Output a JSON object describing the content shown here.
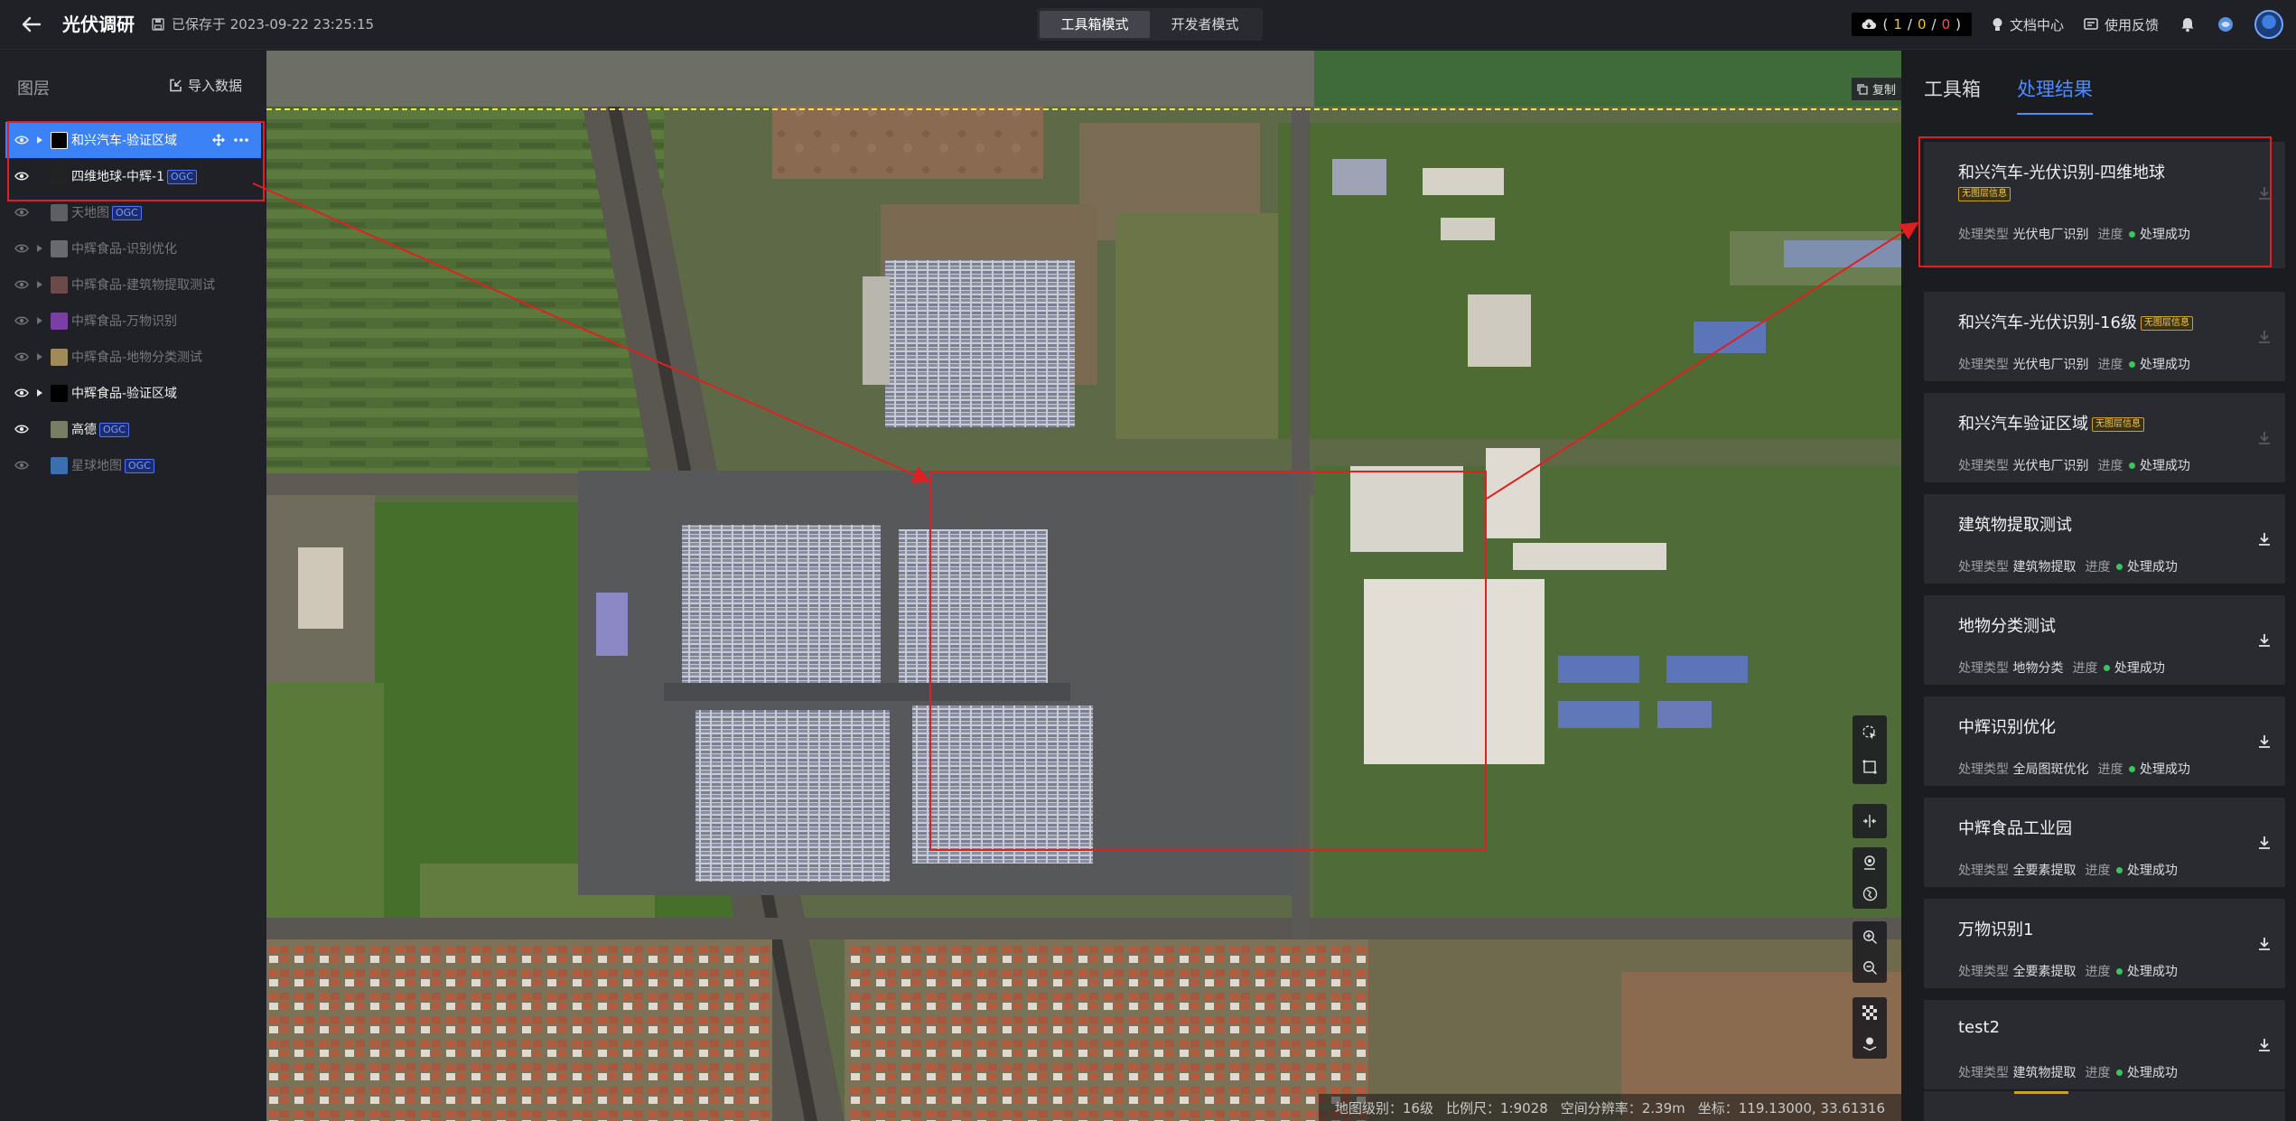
{
  "header": {
    "title": "光伏调研",
    "save_status": "已保存于 2023-09-22 23:25:15",
    "modes": [
      "工具箱模式",
      "开发者模式"
    ],
    "task_counter": {
      "success": "1",
      "running": "0",
      "failed": "0"
    },
    "doc_center": "文档中心",
    "feedback": "使用反馈"
  },
  "layers_panel": {
    "title": "图层",
    "import_label": "导入数据",
    "layers": [
      {
        "name": "和兴汽车-验证区域",
        "ogc": "",
        "swatch": "#000000"
      },
      {
        "name": "四维地球-中辉-1",
        "ogc": "OGC",
        "swatch": "#222222"
      },
      {
        "name": "天地图",
        "ogc": "OGC",
        "swatch": "#5e5f63"
      },
      {
        "name": "中辉食品-识别优化",
        "ogc": "",
        "swatch": "#6a6a6e"
      },
      {
        "name": "中辉食品-建筑物提取测试",
        "ogc": "",
        "swatch": "#6b4a4a"
      },
      {
        "name": "中辉食品-万物识别",
        "ogc": "",
        "swatch": "#7a3fa5"
      },
      {
        "name": "中辉食品-地物分类测试",
        "ogc": "",
        "swatch": "#a08a5a"
      },
      {
        "name": "中辉食品-验证区域",
        "ogc": "",
        "swatch": "#000000"
      },
      {
        "name": "高德",
        "ogc": "OGC",
        "swatch": "#7a7d65"
      },
      {
        "name": "星球地图",
        "ogc": "OGC",
        "swatch": "#3b6fb0"
      }
    ]
  },
  "map": {
    "copy_label": "复制",
    "status": {
      "level": "地图级别：16级",
      "scale": "比例尺：1:9028",
      "resolution": "空间分辨率：2.39m",
      "coords": "坐标：119.13000, 33.61316"
    }
  },
  "results_panel": {
    "tabs": [
      "工具箱",
      "处理结果"
    ],
    "type_label": "处理类型",
    "progress_label": "进度",
    "results": [
      {
        "title": "和兴汽车-光伏识别-四维地球",
        "badge": "无图层信息",
        "type": "光伏电厂识别",
        "status": "处理成功"
      },
      {
        "title": "和兴汽车-光伏识别-16级",
        "badge": "无图层信息",
        "type": "光伏电厂识别",
        "status": "处理成功"
      },
      {
        "title": "和兴汽车验证区域",
        "badge": "无图层信息",
        "type": "光伏电厂识别",
        "status": "处理成功"
      },
      {
        "title": "建筑物提取测试",
        "badge": "",
        "type": "建筑物提取",
        "status": "处理成功"
      },
      {
        "title": "地物分类测试",
        "badge": "",
        "type": "地物分类",
        "status": "处理成功"
      },
      {
        "title": "中辉识别优化",
        "badge": "",
        "type": "全局图斑优化",
        "status": "处理成功"
      },
      {
        "title": "中辉食品工业园",
        "badge": "",
        "type": "全要素提取",
        "status": "处理成功"
      },
      {
        "title": "万物识别1",
        "badge": "",
        "type": "全要素提取",
        "status": "处理成功"
      },
      {
        "title": "test2",
        "badge": "",
        "type": "建筑物提取",
        "status": "处理成功"
      }
    ]
  },
  "colors": {
    "accent": "#3b82f6",
    "success": "#35c759",
    "annotation": "#e02020",
    "ogc": "#4e74ff"
  }
}
